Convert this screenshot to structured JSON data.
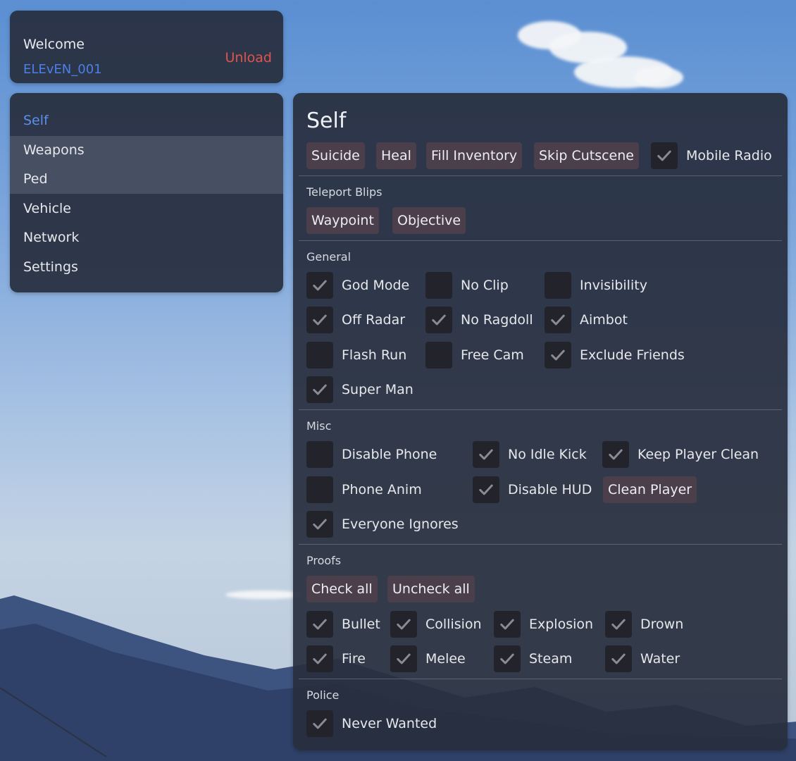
{
  "header": {
    "welcome": "Welcome",
    "username": "ELEvEN_001",
    "unload": "Unload"
  },
  "nav": [
    "Self",
    "Weapons",
    "Ped",
    "Vehicle",
    "Network",
    "Settings"
  ],
  "main": {
    "title": "Self",
    "buttons": [
      "Suicide",
      "Heal",
      "Fill Inventory",
      "Skip Cutscene"
    ],
    "mobile_radio": {
      "label": "Mobile Radio",
      "checked": true
    },
    "teleport": {
      "heading": "Teleport Blips",
      "buttons": [
        "Waypoint",
        "Objective"
      ]
    },
    "general": {
      "heading": "General",
      "options": [
        {
          "label": "God Mode",
          "checked": true
        },
        {
          "label": "No Clip",
          "checked": false
        },
        {
          "label": "Invisibility",
          "checked": false
        },
        {
          "label": "Off Radar",
          "checked": true
        },
        {
          "label": "No Ragdoll",
          "checked": true
        },
        {
          "label": "Aimbot",
          "checked": true
        },
        {
          "label": "Flash Run",
          "checked": false
        },
        {
          "label": "Free Cam",
          "checked": false
        },
        {
          "label": "Exclude Friends",
          "checked": true
        },
        {
          "label": "Super Man",
          "checked": true
        }
      ]
    },
    "misc": {
      "heading": "Misc",
      "options": [
        {
          "label": "Disable Phone",
          "checked": false
        },
        {
          "label": "No Idle Kick",
          "checked": true
        },
        {
          "label": "Keep Player Clean",
          "checked": true
        },
        {
          "label": "Phone Anim",
          "checked": false
        },
        {
          "label": "Disable HUD",
          "checked": true
        },
        {
          "label": "Everyone Ignores",
          "checked": true
        }
      ],
      "clean_button": "Clean Player"
    },
    "proofs": {
      "heading": "Proofs",
      "buttons": [
        "Check all",
        "Uncheck all"
      ],
      "options": [
        {
          "label": "Bullet",
          "checked": true
        },
        {
          "label": "Collision",
          "checked": true
        },
        {
          "label": "Explosion",
          "checked": true
        },
        {
          "label": "Drown",
          "checked": true
        },
        {
          "label": "Fire",
          "checked": true
        },
        {
          "label": "Melee",
          "checked": true
        },
        {
          "label": "Steam",
          "checked": true
        },
        {
          "label": "Water",
          "checked": true
        }
      ]
    },
    "police": {
      "heading": "Police",
      "options": [
        {
          "label": "Never Wanted",
          "checked": true
        }
      ]
    }
  },
  "colors": {
    "accent": "#5b8fe9",
    "username": "#4d7fe8",
    "unload": "#e0544f",
    "button_bg": "#4a3f4a",
    "panel_bg": "#282e3e"
  }
}
